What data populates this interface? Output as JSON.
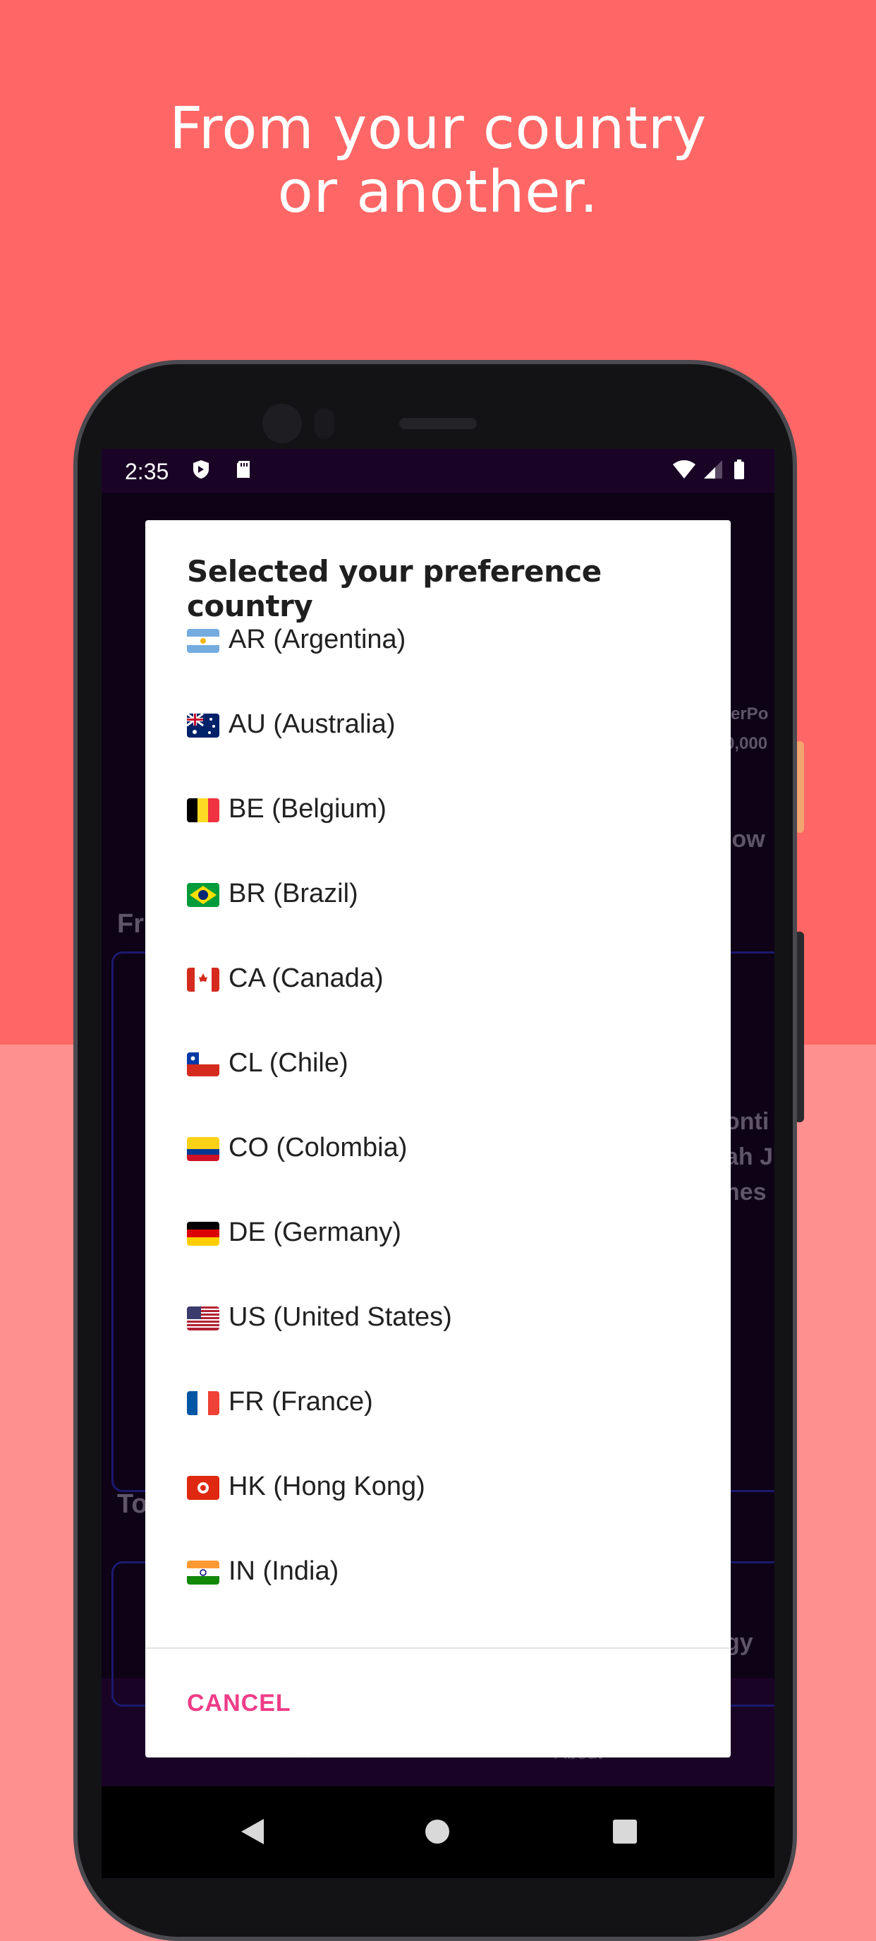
{
  "headline": {
    "line1": "From your country",
    "line2": "or another."
  },
  "status_bar": {
    "time": "2:35",
    "icons": [
      "shield-icon",
      "sd-card-icon",
      "wifi-icon",
      "signal-icon",
      "battery-icon"
    ]
  },
  "background_app": {
    "section_fragment_1": "Fr",
    "section_fragment_2": "To",
    "nav_tabs": [
      "Feed",
      "About"
    ],
    "fragments": [
      "terPo",
      "0,000",
      "low",
      "onti",
      "ah J",
      "nes",
      "gy"
    ]
  },
  "dialog": {
    "title": "Selected your preference country",
    "countries": [
      {
        "label": "AR (Argentina)",
        "flag": "flag-ar"
      },
      {
        "label": "AU (Australia)",
        "flag": "flag-au"
      },
      {
        "label": "BE (Belgium)",
        "flag": "flag-be"
      },
      {
        "label": "BR (Brazil)",
        "flag": "flag-br"
      },
      {
        "label": "CA (Canada)",
        "flag": "flag-ca"
      },
      {
        "label": "CL (Chile)",
        "flag": "flag-cl"
      },
      {
        "label": "CO (Colombia)",
        "flag": "flag-co"
      },
      {
        "label": "DE (Germany)",
        "flag": "flag-de"
      },
      {
        "label": "US (United States)",
        "flag": "flag-us"
      },
      {
        "label": "FR (France)",
        "flag": "flag-fr"
      },
      {
        "label": "HK (Hong Kong)",
        "flag": "flag-hk"
      },
      {
        "label": "IN (India)",
        "flag": "flag-in"
      }
    ],
    "cancel_label": "CANCEL"
  },
  "colors": {
    "bg_top": "#fe6766",
    "bg_bottom": "#fe9090",
    "accent": "#ef3c88"
  }
}
